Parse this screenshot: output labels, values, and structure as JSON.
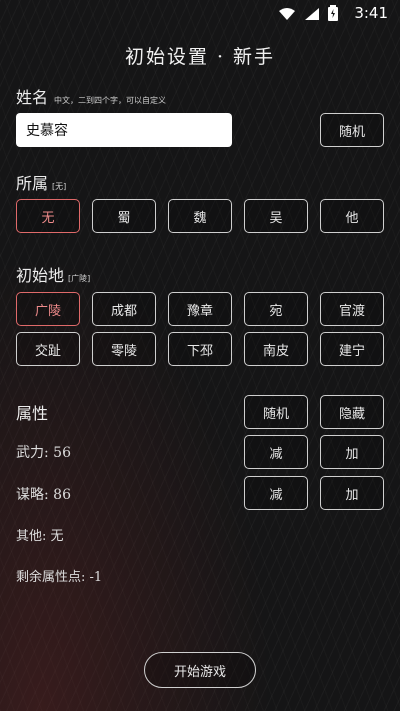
{
  "status_bar": {
    "time": "3:41"
  },
  "page": {
    "title": "初始设置 · 新手"
  },
  "name_section": {
    "label": "姓名",
    "hint": "中文，二到四个字，可以自定义",
    "value": "史慕容",
    "random_label": "随机"
  },
  "faction_section": {
    "label": "所属",
    "current": "[无]",
    "options": [
      "无",
      "蜀",
      "魏",
      "吴",
      "他"
    ],
    "selected_index": 0
  },
  "origin_section": {
    "label": "初始地",
    "current": "[广陵]",
    "options": [
      "广陵",
      "成都",
      "豫章",
      "宛",
      "官渡",
      "交趾",
      "零陵",
      "下邳",
      "南皮",
      "建宁"
    ],
    "selected_index": 0
  },
  "attribute_section": {
    "label": "属性",
    "random_label": "随机",
    "hide_label": "隐藏",
    "wuli": {
      "label": "武力",
      "value": "56"
    },
    "mouluo": {
      "label": "谋略",
      "value": "86"
    },
    "minus_label": "减",
    "plus_label": "加",
    "other": {
      "label": "其他",
      "value": "无"
    },
    "remaining": {
      "label": "剩余属性点",
      "value": "-1"
    }
  },
  "start_label": "开始游戏",
  "colors": {
    "accent_selected": "#e06a6a",
    "background": "#151516"
  }
}
